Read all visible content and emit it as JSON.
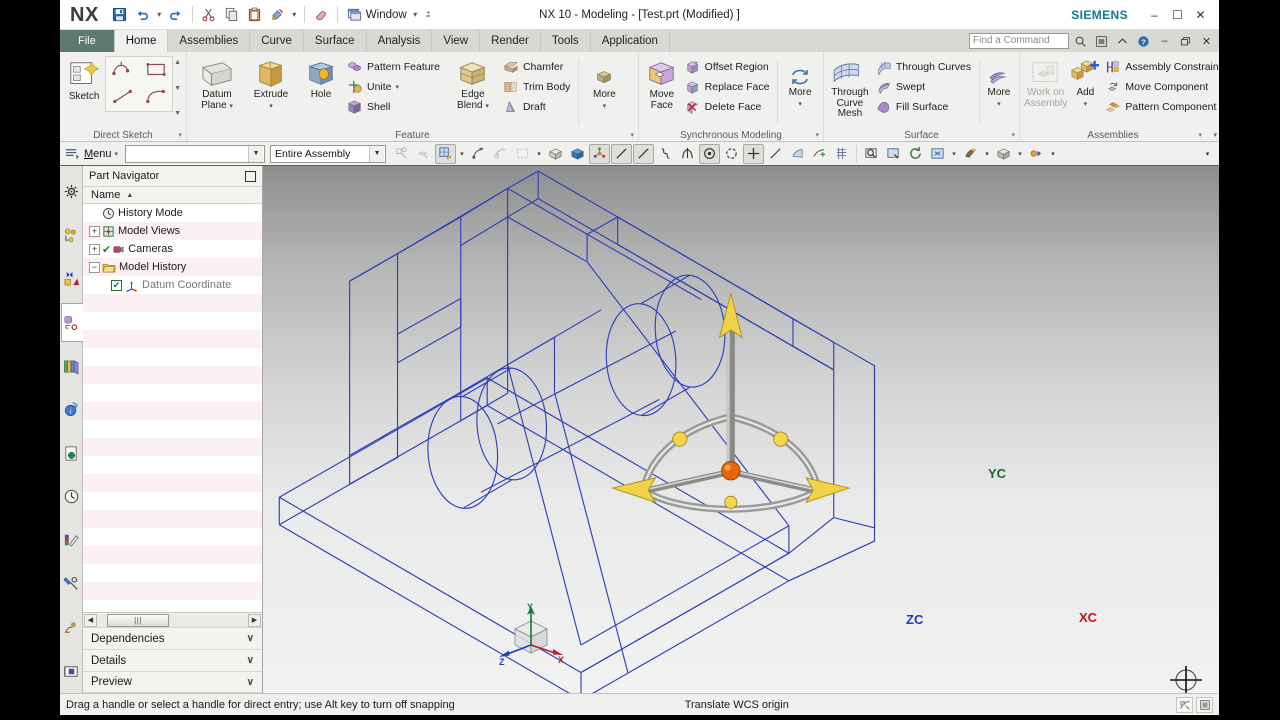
{
  "window": {
    "title": "NX 10 - Modeling - [Test.prt (Modified) ]",
    "brand": "SIEMENS",
    "logo": "NX",
    "minimize": "–",
    "maximize": "☐",
    "close": "✕"
  },
  "quick_access": {
    "window_label": "Window",
    "items": [
      {
        "name": "save-icon",
        "glyph": "save"
      },
      {
        "name": "undo-icon",
        "glyph": "undo"
      },
      {
        "name": "redo-icon",
        "glyph": "redo"
      },
      {
        "name": "cut-icon",
        "glyph": "cut"
      },
      {
        "name": "copy-icon",
        "glyph": "copy"
      },
      {
        "name": "paste-icon",
        "glyph": "paste"
      },
      {
        "name": "format-painter-icon",
        "glyph": "painter"
      },
      {
        "name": "eraser-icon",
        "glyph": "eraser"
      }
    ]
  },
  "tabs": [
    {
      "label": "File",
      "id": "file",
      "active": false
    },
    {
      "label": "Home",
      "id": "home",
      "active": true
    },
    {
      "label": "Assemblies",
      "id": "assemblies",
      "active": false
    },
    {
      "label": "Curve",
      "id": "curve",
      "active": false
    },
    {
      "label": "Surface",
      "id": "surface",
      "active": false
    },
    {
      "label": "Analysis",
      "id": "analysis",
      "active": false
    },
    {
      "label": "View",
      "id": "view",
      "active": false
    },
    {
      "label": "Render",
      "id": "render",
      "active": false
    },
    {
      "label": "Tools",
      "id": "tools",
      "active": false
    },
    {
      "label": "Application",
      "id": "application",
      "active": false
    }
  ],
  "tabbar_right": {
    "find_placeholder": "Find a Command",
    "search_icon": "search-icon",
    "restore_icon": "restore-ribbon-icon",
    "collapse_icon": "collapse-ribbon-icon",
    "help_icon": "help-icon",
    "minimize": "–",
    "restore": "❐",
    "close": "✕"
  },
  "ribbon": {
    "groups": [
      {
        "label": "Direct Sketch",
        "big": [
          {
            "label": "Sketch",
            "icon": "sketch-icon"
          }
        ],
        "grid": [
          {
            "name": "profile-icon"
          },
          {
            "name": "rectangle-icon"
          },
          {
            "name": "line-icon"
          },
          {
            "name": "arc-icon"
          }
        ]
      },
      {
        "label": "Feature",
        "big": [
          {
            "label": "Datum\nPlane",
            "icon": "datum-plane-icon",
            "dropdown": true
          },
          {
            "label": "Extrude",
            "icon": "extrude-icon",
            "dropdown": true
          },
          {
            "label": "Hole",
            "icon": "hole-icon",
            "dropdown": false
          }
        ],
        "small1": [
          {
            "label": "Pattern Feature",
            "icon": "pattern-feature-icon",
            "dropdown": false
          },
          {
            "label": "Unite",
            "icon": "unite-icon",
            "dropdown": true
          },
          {
            "label": "Shell",
            "icon": "shell-icon",
            "dropdown": false
          }
        ],
        "big2": [
          {
            "label": "Edge\nBlend",
            "icon": "edge-blend-icon",
            "dropdown": true
          }
        ],
        "small2": [
          {
            "label": "Chamfer",
            "icon": "chamfer-icon",
            "dropdown": false
          },
          {
            "label": "Trim Body",
            "icon": "trim-body-icon",
            "dropdown": false
          },
          {
            "label": "Draft",
            "icon": "draft-icon",
            "dropdown": false
          }
        ],
        "more": {
          "label": "More",
          "icon": "more-feature-icon"
        }
      },
      {
        "label": "Synchronous Modeling",
        "big": [
          {
            "label": "Move\nFace",
            "icon": "move-face-icon"
          }
        ],
        "small1": [
          {
            "label": "Offset Region",
            "icon": "offset-region-icon"
          },
          {
            "label": "Replace Face",
            "icon": "replace-face-icon"
          },
          {
            "label": "Delete Face",
            "icon": "delete-face-icon"
          }
        ],
        "more": {
          "label": "More",
          "icon": "more-sync-icon"
        }
      },
      {
        "label": "Surface",
        "big": [
          {
            "label": "Through\nCurve Mesh",
            "icon": "through-curve-mesh-icon"
          }
        ],
        "small1": [
          {
            "label": "Through Curves",
            "icon": "through-curves-icon"
          },
          {
            "label": "Swept",
            "icon": "swept-icon"
          },
          {
            "label": "Fill Surface",
            "icon": "fill-surface-icon"
          }
        ],
        "more": {
          "label": "More",
          "icon": "more-surface-icon"
        }
      },
      {
        "label": "Assemblies",
        "big": [
          {
            "label": "Work on\nAssembly",
            "icon": "work-on-assembly-icon",
            "disabled": true
          },
          {
            "label": "Add",
            "icon": "add-component-icon",
            "dropdown": true
          }
        ],
        "small1": [
          {
            "label": "Assembly Constraints",
            "icon": "assembly-constraints-icon"
          },
          {
            "label": "Move Component",
            "icon": "move-component-icon"
          },
          {
            "label": "Pattern Component",
            "icon": "pattern-component-icon"
          }
        ]
      }
    ]
  },
  "toolbar": {
    "menu_label": "Menu",
    "selection_filter_value": "",
    "scope_value": "Entire Assembly",
    "command_value": "",
    "icons": [
      {
        "name": "select-feature-icon",
        "disabled": true
      },
      {
        "name": "select-body-icon",
        "disabled": true
      },
      {
        "name": "snap-point-icon",
        "disabled": false,
        "dropdown": true,
        "pressed": true
      },
      {
        "name": "point-on-curve-icon",
        "disabled": false
      },
      {
        "name": "face-filter-icon",
        "disabled": true
      },
      {
        "name": "rectangle-select-icon",
        "disabled": true,
        "dropdown": true
      },
      {
        "name": "shaded-wireframe-icon",
        "disabled": false
      },
      {
        "name": "shaded-icon",
        "disabled": false
      },
      {
        "name": "datum-display-icon",
        "pressed": true
      },
      {
        "name": "wireframe-line-icon",
        "pressed": true
      },
      {
        "name": "wireframe-line2-icon",
        "pressed": true
      },
      {
        "name": "spline-icon"
      },
      {
        "name": "intersection-icon"
      },
      {
        "name": "circle-center-icon",
        "pressed": true
      },
      {
        "name": "arc-center-icon"
      },
      {
        "name": "midpoint-icon",
        "pressed": true
      },
      {
        "name": "endpoint-icon"
      },
      {
        "name": "quadrant-icon"
      },
      {
        "name": "point-constructor-icon"
      },
      {
        "name": "grid-snap-icon"
      },
      {
        "name": "zoom-fit-icon"
      },
      {
        "name": "zoom-window-icon"
      },
      {
        "name": "rotate-view-icon"
      },
      {
        "name": "fit-view-icon",
        "dropdown": true
      },
      {
        "name": "render-style-icon",
        "dropdown": true
      },
      {
        "name": "orient-view-icon",
        "dropdown": true
      },
      {
        "name": "visualization-icon",
        "dropdown": true
      }
    ]
  },
  "resource_bar": {
    "items": [
      {
        "name": "assembly-navigator-icon",
        "selected": false
      },
      {
        "name": "constraint-navigator-icon",
        "selected": false
      },
      {
        "name": "part-navigator-icon",
        "selected": false
      },
      {
        "name": "reuse-library-icon",
        "selected": true
      },
      {
        "name": "history-palette-icon",
        "selected": false
      },
      {
        "name": "internet-explorer-icon",
        "selected": false
      },
      {
        "name": "html-help-icon",
        "selected": false
      },
      {
        "name": "history-clock-icon",
        "selected": false
      },
      {
        "name": "system-materials-icon",
        "selected": false
      },
      {
        "name": "process-studio-icon",
        "selected": false
      },
      {
        "name": "roles-icon",
        "selected": false
      },
      {
        "name": "web-browser-icon",
        "selected": false
      }
    ]
  },
  "part_navigator": {
    "title": "Part Navigator",
    "pin_icon": "pin-icon",
    "column_header": "Name",
    "sort_arrow": "▲",
    "tree": [
      {
        "label": "History Mode",
        "icon": "clock-icon",
        "expander": "",
        "indent": 1,
        "checkbox": false
      },
      {
        "label": "Model Views",
        "icon": "model-views-icon",
        "expander": "+",
        "indent": 1,
        "checkbox": false
      },
      {
        "label": "Cameras",
        "icon": "camera-icon",
        "expander": "+",
        "indent": 1,
        "checkbox": false,
        "check_mark": true
      },
      {
        "label": "Model History",
        "icon": "folder-icon",
        "expander": "−",
        "indent": 1,
        "checkbox": false
      },
      {
        "label": "Datum Coordinate",
        "icon": "datum-csys-icon",
        "expander": "",
        "indent": 2,
        "checkbox": true,
        "dim": true
      }
    ],
    "scrollbar": {
      "left_arrow": "◀",
      "right_arrow": "▶",
      "thumb": "⦀"
    },
    "sections": [
      {
        "label": "Dependencies",
        "chevron": "∨"
      },
      {
        "label": "Details",
        "chevron": "∨"
      },
      {
        "label": "Preview",
        "chevron": "∨"
      }
    ]
  },
  "viewport": {
    "wcs": {
      "x_label": "XC",
      "y_label": "YC",
      "z_label": "ZC",
      "x_color": "#cc1414",
      "y_color": "#1a6b2a",
      "z_color": "#1a39cc",
      "origin_color": "#e8650a",
      "handle_color": "#f2d24a"
    },
    "triad": {
      "x_label": "X",
      "y_label": "Y",
      "z_label": "Z",
      "x_color": "#b02030",
      "y_color": "#1f7a3c",
      "z_color": "#2040c0"
    },
    "model_color": "#2b3fb8",
    "cursor": "move-cursor-icon"
  },
  "status_bar": {
    "message": "Drag a handle or select a handle for direct entry; use Alt key to turn off snapping",
    "mode": "Translate WCS origin",
    "icons": [
      {
        "name": "selection-filter-status-icon"
      },
      {
        "name": "window-status-icon"
      }
    ]
  }
}
